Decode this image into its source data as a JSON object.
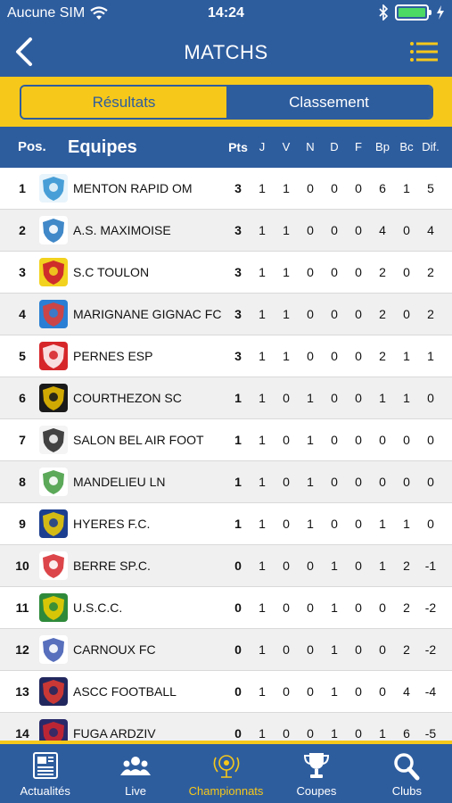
{
  "status_bar": {
    "carrier": "Aucune SIM",
    "time": "14:24"
  },
  "nav": {
    "title": "MATCHS"
  },
  "segments": [
    {
      "label": "Résultats",
      "active": true
    },
    {
      "label": "Classement",
      "active": false
    }
  ],
  "columns": {
    "pos": "Pos.",
    "team": "Equipes",
    "pts": "Pts",
    "stats": [
      "J",
      "V",
      "N",
      "D",
      "F",
      "Bp",
      "Bc",
      "Dif."
    ]
  },
  "standings": [
    {
      "pos": "1",
      "team": "MENTON RAPID OM",
      "pts": "3",
      "stats": [
        "1",
        "1",
        "0",
        "0",
        "0",
        "6",
        "1",
        "5"
      ],
      "logo": {
        "icon": "menton-rapid-om-logo",
        "bg": "#e8f4fb",
        "fg": "#2b8fd0"
      }
    },
    {
      "pos": "2",
      "team": "A.S. MAXIMOISE",
      "pts": "3",
      "stats": [
        "1",
        "1",
        "0",
        "0",
        "0",
        "4",
        "0",
        "4"
      ],
      "logo": {
        "icon": "as-maximoise-logo",
        "bg": "#ffffff",
        "fg": "#1e73be"
      }
    },
    {
      "pos": "3",
      "team": "S.C TOULON",
      "pts": "3",
      "stats": [
        "1",
        "1",
        "0",
        "0",
        "0",
        "2",
        "0",
        "2"
      ],
      "logo": {
        "icon": "sc-toulon-logo",
        "bg": "#f2d21e",
        "fg": "#c8102e"
      }
    },
    {
      "pos": "4",
      "team": "MARIGNANE GIGNAC FC",
      "pts": "3",
      "stats": [
        "1",
        "1",
        "0",
        "0",
        "0",
        "2",
        "0",
        "2"
      ],
      "logo": {
        "icon": "marignane-gignac-logo",
        "bg": "#2a7fd4",
        "fg": "#e63b2e"
      }
    },
    {
      "pos": "5",
      "team": "PERNES ESP",
      "pts": "3",
      "stats": [
        "1",
        "1",
        "0",
        "0",
        "0",
        "2",
        "1",
        "1"
      ],
      "logo": {
        "icon": "pernes-esp-logo",
        "bg": "#d6262a",
        "fg": "#ffffff"
      }
    },
    {
      "pos": "6",
      "team": "COURTHEZON SC",
      "pts": "1",
      "stats": [
        "1",
        "0",
        "1",
        "0",
        "0",
        "1",
        "1",
        "0"
      ],
      "logo": {
        "icon": "courthezon-sc-logo",
        "bg": "#1a1a1a",
        "fg": "#f2c300"
      }
    },
    {
      "pos": "7",
      "team": "SALON BEL AIR FOOT",
      "pts": "1",
      "stats": [
        "1",
        "0",
        "1",
        "0",
        "0",
        "0",
        "0",
        "0"
      ],
      "logo": {
        "icon": "salon-bel-air-logo",
        "bg": "#f4f4f4",
        "fg": "#222222"
      }
    },
    {
      "pos": "8",
      "team": "MANDELIEU LN",
      "pts": "1",
      "stats": [
        "1",
        "0",
        "1",
        "0",
        "0",
        "0",
        "0",
        "0"
      ],
      "logo": {
        "icon": "mandelieu-ln-logo",
        "bg": "#ffffff",
        "fg": "#3e9a3c"
      }
    },
    {
      "pos": "9",
      "team": "HYERES F.C.",
      "pts": "1",
      "stats": [
        "1",
        "0",
        "1",
        "0",
        "0",
        "1",
        "1",
        "0"
      ],
      "logo": {
        "icon": "hyeres-fc-logo",
        "bg": "#1d3f8f",
        "fg": "#f4d000"
      }
    },
    {
      "pos": "10",
      "team": "BERRE SP.C.",
      "pts": "0",
      "stats": [
        "1",
        "0",
        "0",
        "1",
        "0",
        "1",
        "2",
        "-1"
      ],
      "logo": {
        "icon": "berre-spc-logo",
        "bg": "#ffffff",
        "fg": "#d6262a"
      }
    },
    {
      "pos": "11",
      "team": "U.S.C.C.",
      "pts": "0",
      "stats": [
        "1",
        "0",
        "0",
        "1",
        "0",
        "0",
        "2",
        "-2"
      ],
      "logo": {
        "icon": "uscc-logo",
        "bg": "#2e8a3a",
        "fg": "#f4d000"
      }
    },
    {
      "pos": "12",
      "team": "CARNOUX FC",
      "pts": "0",
      "stats": [
        "1",
        "0",
        "0",
        "1",
        "0",
        "0",
        "2",
        "-2"
      ],
      "logo": {
        "icon": "carnoux-fc-logo",
        "bg": "#ffffff",
        "fg": "#3a56b0"
      }
    },
    {
      "pos": "13",
      "team": "ASCC FOOTBALL",
      "pts": "0",
      "stats": [
        "1",
        "0",
        "0",
        "1",
        "0",
        "0",
        "4",
        "-4"
      ],
      "logo": {
        "icon": "ascc-football-logo",
        "bg": "#22285e",
        "fg": "#e63b2e"
      }
    },
    {
      "pos": "14",
      "team": "FUGA ARDZIV",
      "pts": "0",
      "stats": [
        "1",
        "0",
        "0",
        "1",
        "0",
        "1",
        "6",
        "-5"
      ],
      "logo": {
        "icon": "fuga-ardziv-logo",
        "bg": "#2a2a6a",
        "fg": "#d6262a"
      }
    }
  ],
  "tabs": [
    {
      "label": "Actualités",
      "icon": "newspaper-icon",
      "active": false
    },
    {
      "label": "Live",
      "icon": "people-icon",
      "active": false
    },
    {
      "label": "Championnats",
      "icon": "championship-trophy-icon",
      "active": true
    },
    {
      "label": "Coupes",
      "icon": "cup-trophy-icon",
      "active": false
    },
    {
      "label": "Clubs",
      "icon": "search-icon",
      "active": false
    }
  ],
  "colors": {
    "primary": "#2e5d9e",
    "accent": "#f6c81a",
    "row_alt": "#f0f0f0"
  }
}
